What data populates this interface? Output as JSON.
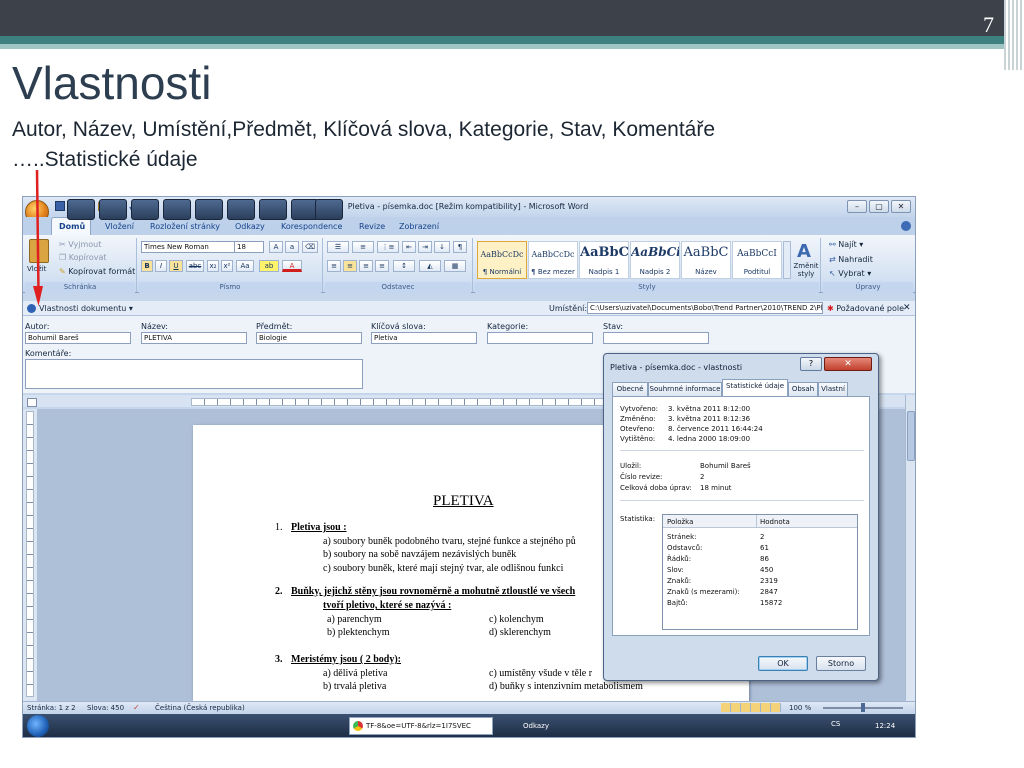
{
  "slide": {
    "number": "7",
    "title": "Vlastnosti",
    "subtitle_line1": "Autor, Název, Umístění,Předmět, Klíčová slova, Kategorie, Stav, Komentáře",
    "subtitle_line2": "…..Statistické údaje",
    "accent_color": "#3e7f80",
    "arrow_color": "#e02020"
  },
  "window": {
    "title": "Pletiva - písemka.doc [Režim kompatibility] - Microsoft Word",
    "tabs": [
      "Domů",
      "Vložení",
      "Rozložení stránky",
      "Odkazy",
      "Korespondence",
      "Revize",
      "Zobrazení"
    ],
    "active_tab": "Domů"
  },
  "ribbon": {
    "clipboard": {
      "paste": "Vložit",
      "cut": "Vyjmout",
      "copy": "Kopírovat",
      "format_painter": "Kopírovat formát",
      "label": "Schránka"
    },
    "font": {
      "family": "Times New Roman",
      "size": "18",
      "label": "Písmo"
    },
    "paragraph": {
      "label": "Odstavec"
    },
    "styles": {
      "label": "Styly",
      "items": [
        {
          "sample": "AaBbCcDc",
          "name": "¶ Normální"
        },
        {
          "sample": "AaBbCcDc",
          "name": "¶ Bez mezer"
        },
        {
          "sample": "AaBbC",
          "name": "Nadpis 1"
        },
        {
          "sample": "AaBbCi",
          "name": "Nadpis 2"
        },
        {
          "sample": "AaBbC",
          "name": "Název"
        },
        {
          "sample": "AaBbCcI",
          "name": "Podtitul"
        }
      ],
      "change_styles": "Změnit styly"
    },
    "editing": {
      "label": "Úpravy",
      "find": "Najít",
      "replace": "Nahradit",
      "select": "Vybrat"
    }
  },
  "doc_properties": {
    "title": "Vlastnosti dokumentu",
    "location_label": "Umístění:",
    "location_value": "C:\\Users\\uzivatel\\Documents\\Bobo\\Trend Partner\\2010\\TREND 2\\Plet",
    "required_fields": "Požadované pole",
    "fields": [
      {
        "label": "Autor:",
        "value": "Bohumil Bareš"
      },
      {
        "label": "Název:",
        "value": "PLETIVA"
      },
      {
        "label": "Předmět:",
        "value": "Biologie"
      },
      {
        "label": "Klíčová slova:",
        "value": "Pletiva"
      },
      {
        "label": "Kategorie:",
        "value": ""
      },
      {
        "label": "Stav:",
        "value": ""
      }
    ],
    "comments_label": "Komentáře:"
  },
  "document": {
    "heading": "PLETIVA",
    "l1_num": "1.",
    "l1_title": "Pletiva jsou :",
    "l1_a": "a) soubory buněk podobného tvaru, stejné funkce a stejného pů",
    "l1_b": "b) soubory na sobě navzájem nezávislých buněk",
    "l1_c": "c) soubory buněk, které mají stejný tvar, ale odlišnou funkci",
    "l2_num": "2.",
    "l2_title": "Buňky, jejichž stěny jsou rovnoměrně a mohutně ztloustlé ve všech",
    "l2_title2": "tvoří pletivo, které se nazývá :",
    "l2_a": "a) parenchym",
    "l2_c": "c) kolenchym",
    "l2_b": "b) plektenchym",
    "l2_d": "d) sklerenchym",
    "l3_num": "3.",
    "l3_title": "Meristémy jsou ( 2 body):",
    "l3_a": "a) dělivá pletiva",
    "l3_c": "c) umístěny všude v těle r",
    "l3_b": "b) trvalá pletiva",
    "l3_d": "d) buňky s intenzivním metabolismem"
  },
  "statusbar": {
    "page": "Stránka: 1 z 2",
    "words": "Slova: 450",
    "language": "Čeština (Česká republika)",
    "zoom": "100 %"
  },
  "taskbar": {
    "browser_tab": "TF-8&oe=UTF-8&rlz=1I7SVEC",
    "links": "Odkazy",
    "lang": "CS",
    "time": "12:24"
  },
  "dialog": {
    "title": "Pletiva - písemka.doc - vlastnosti",
    "help": "?",
    "tabs": [
      "Obecné",
      "Souhrnné informace",
      "Statistické údaje",
      "Obsah",
      "Vlastní"
    ],
    "active_tab": "Statistické údaje",
    "dates": [
      {
        "label": "Vytvořeno:",
        "value": "3. května 2011 8:12:00"
      },
      {
        "label": "Změněno:",
        "value": "3. května 2011 8:12:36"
      },
      {
        "label": "Otevřeno:",
        "value": "8. července 2011 16:44:24"
      },
      {
        "label": "Vytištěno:",
        "value": "4. ledna 2000 18:09:00"
      }
    ],
    "info": [
      {
        "label": "Uložil:",
        "value": "Bohumil Bareš"
      },
      {
        "label": "Číslo revize:",
        "value": "2"
      },
      {
        "label": "Celková doba úprav:",
        "value": "18 minut"
      }
    ],
    "stats_label": "Statistika:",
    "stats_header": [
      "Položka",
      "Hodnota"
    ],
    "stats": [
      {
        "item": "Stránek:",
        "value": "2"
      },
      {
        "item": "Odstavců:",
        "value": "61"
      },
      {
        "item": "Řádků:",
        "value": "86"
      },
      {
        "item": "Slov:",
        "value": "450"
      },
      {
        "item": "Znaků:",
        "value": "2319"
      },
      {
        "item": "Znaků (s mezerami):",
        "value": "2847"
      },
      {
        "item": "Bajtů:",
        "value": "15872"
      }
    ],
    "ok": "OK",
    "cancel": "Storno"
  }
}
